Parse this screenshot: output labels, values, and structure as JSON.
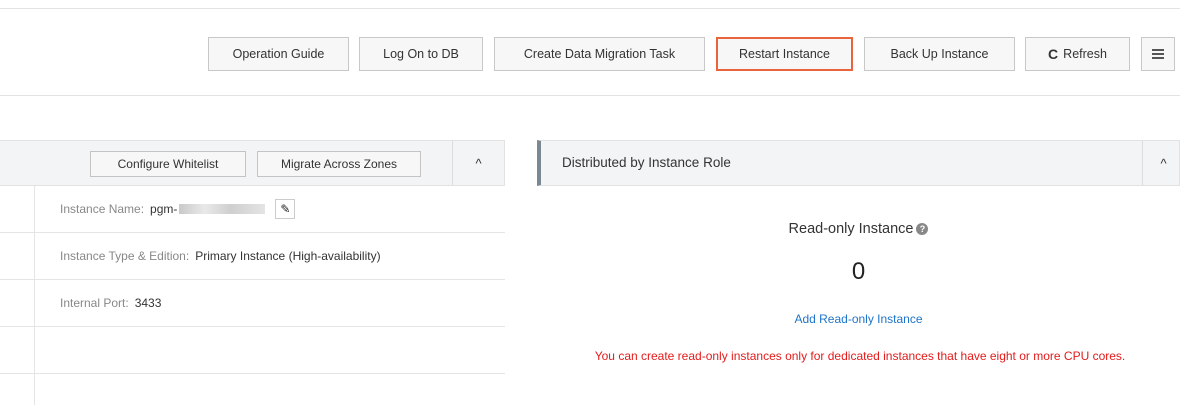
{
  "toolbar": {
    "operation_guide": "Operation Guide",
    "log_on_db": "Log On to DB",
    "create_migration": "Create Data Migration Task",
    "restart_instance": "Restart Instance",
    "back_up_instance": "Back Up Instance",
    "refresh_icon": "C",
    "refresh": "Refresh",
    "highlight_color": "#e8643c"
  },
  "basic_info": {
    "configure_whitelist": "Configure Whitelist",
    "migrate_zones": "Migrate Across Zones",
    "collapse_icon": "^",
    "instance_name_label": "Instance Name:",
    "instance_name_prefix": "pgm-",
    "edit_icon": "✎",
    "instance_type_label": "Instance Type & Edition:",
    "instance_type_value": "Primary Instance (High-availability)",
    "internal_port_label": "Internal Port:",
    "internal_port_value": "3433"
  },
  "role_panel": {
    "title": "Distributed by Instance Role",
    "collapse_icon": "^",
    "read_only_title": "Read-only Instance",
    "help_icon": "?",
    "read_only_count": "0",
    "add_link": "Add Read-only Instance",
    "warning": "You can create read-only instances only for dedicated instances that have eight or more CPU cores.",
    "link_color": "#1e74c8",
    "warning_color": "#e41b1b"
  }
}
